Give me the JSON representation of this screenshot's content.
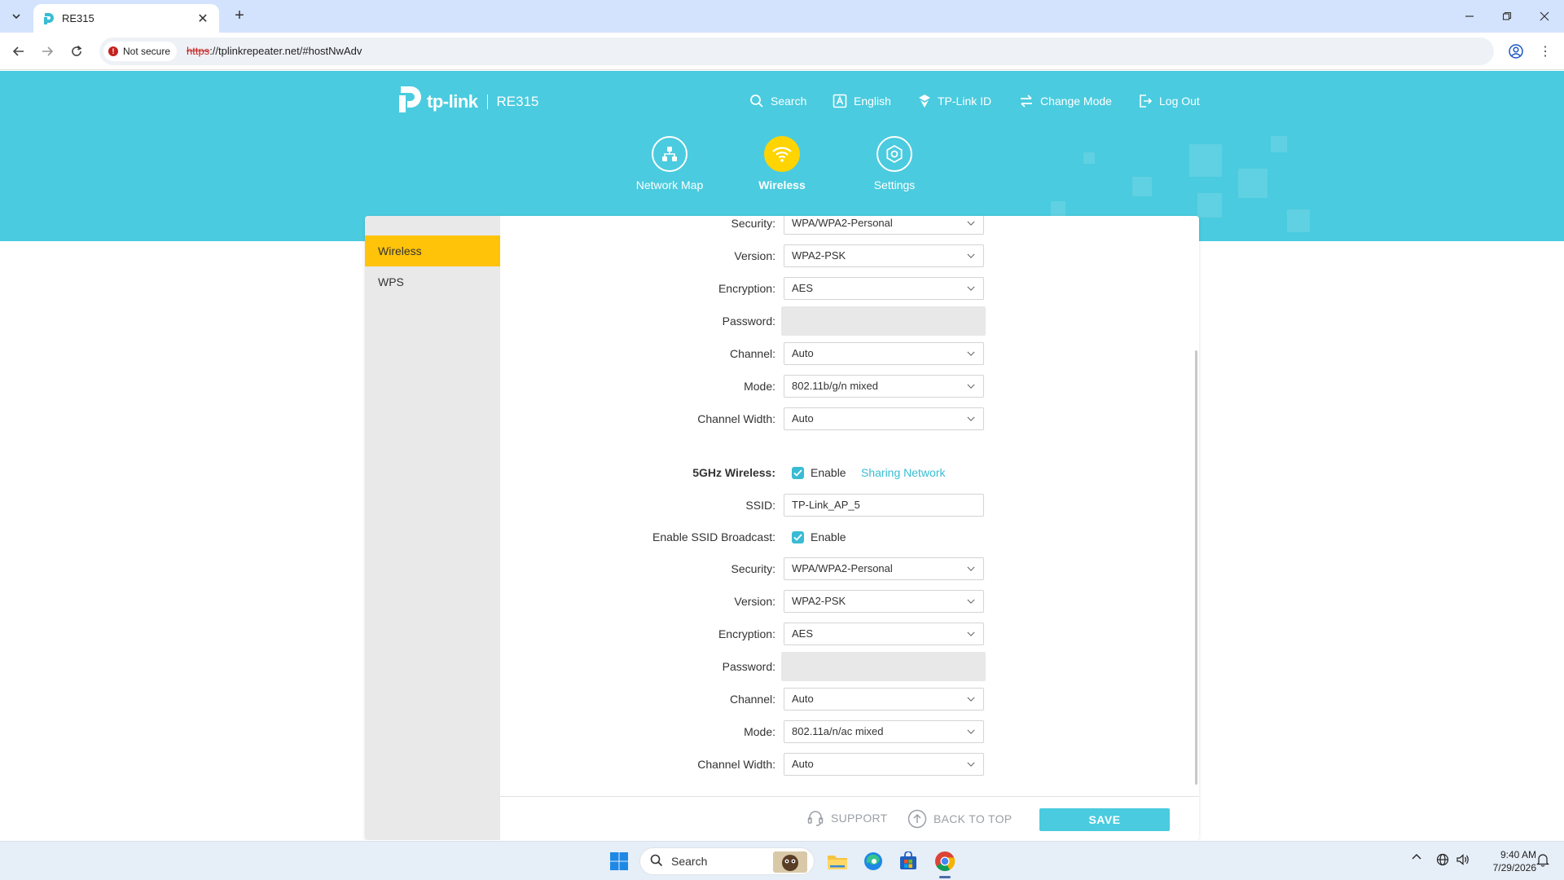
{
  "browser": {
    "tab_title": "RE315",
    "new_tab": "+",
    "security_chip": "Not secure",
    "url_protocol": "https",
    "url_rest": "://tplinkrepeater.net/#hostNwAdv"
  },
  "header": {
    "brand": "tp-link",
    "model": "RE315",
    "links": {
      "search": "Search",
      "language": "English",
      "tplink_id": "TP-Link ID",
      "change_mode": "Change Mode",
      "logout": "Log Out"
    }
  },
  "mainnav": {
    "network_map": "Network Map",
    "wireless": "Wireless",
    "settings": "Settings",
    "active": "Wireless"
  },
  "sidebar": {
    "items": [
      {
        "label": "Wireless",
        "active": true
      },
      {
        "label": "WPS",
        "active": false
      }
    ]
  },
  "band24": {
    "security": {
      "label": "Security:",
      "value": "WPA/WPA2-Personal"
    },
    "version": {
      "label": "Version:",
      "value": "WPA2-PSK"
    },
    "encryption": {
      "label": "Encryption:",
      "value": "AES"
    },
    "password": {
      "label": "Password:",
      "value": ""
    },
    "channel": {
      "label": "Channel:",
      "value": "Auto"
    },
    "mode": {
      "label": "Mode:",
      "value": "802.11b/g/n mixed"
    },
    "channel_width": {
      "label": "Channel Width:",
      "value": "Auto"
    }
  },
  "band5": {
    "wireless": {
      "label": "5GHz Wireless:",
      "enable": "Enable",
      "checked": true,
      "sharing_link": "Sharing Network"
    },
    "ssid": {
      "label": "SSID:",
      "value": "TP-Link_AP_5"
    },
    "broadcast": {
      "label": "Enable SSID Broadcast:",
      "enable": "Enable",
      "checked": true
    },
    "security": {
      "label": "Security:",
      "value": "WPA/WPA2-Personal"
    },
    "version": {
      "label": "Version:",
      "value": "WPA2-PSK"
    },
    "encryption": {
      "label": "Encryption:",
      "value": "AES"
    },
    "password": {
      "label": "Password:",
      "value": ""
    },
    "channel": {
      "label": "Channel:",
      "value": "Auto"
    },
    "mode": {
      "label": "Mode:",
      "value": "802.11a/n/ac mixed"
    },
    "channel_width": {
      "label": "Channel Width:",
      "value": "Auto"
    }
  },
  "footer": {
    "support": "SUPPORT",
    "back_to_top": "BACK TO TOP",
    "save": "SAVE"
  },
  "taskbar": {
    "search_label": "Search",
    "time": "9:40 AM",
    "date": "7/29/2026"
  },
  "colors": {
    "banner": "#4acbdf",
    "accent_yellow": "#ffc30a",
    "active_nav": "#ffd400",
    "checkbox": "#39bcd3",
    "insecure_red": "#c5221f"
  }
}
